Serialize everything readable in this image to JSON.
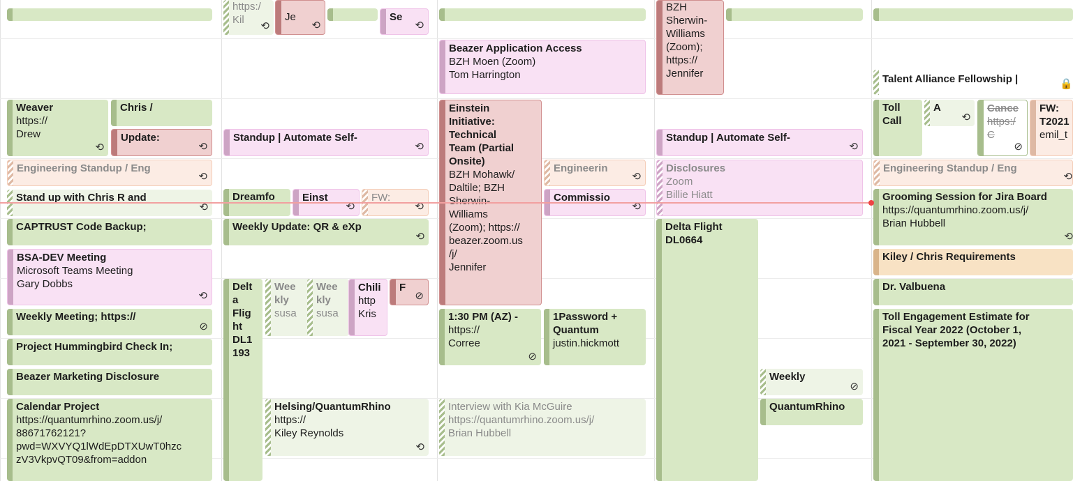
{
  "icons": {
    "repeat": "⟲",
    "no_sync": "⊘",
    "lock": "🔒"
  },
  "allday": {
    "d1": "",
    "d2a": "https:/\nKil",
    "d2b": "Je",
    "d2c": "Se",
    "d3": "",
    "d4a": "BZH\nSherwin-\nWilliams\n(Zoom);\nhttps://\nJennifer"
  },
  "events": {
    "beazer_app": {
      "title": "Beazer Application Access",
      "sub": "BZH Moen (Zoom)\nTom Harrington"
    },
    "talent": {
      "title": "Talent Alliance Fellowship |"
    },
    "weaver": {
      "title": "Weaver",
      "sub": "https://\nDrew"
    },
    "chris": {
      "title": "Chris /"
    },
    "update": {
      "title": "Update:"
    },
    "standup1": {
      "title": "Standup | Automate Self-"
    },
    "einstein": {
      "title": "Einstein\nInitiative:\nTechnical\nTeam (Partial\nOnsite)",
      "sub": "BZH Mohawk/\nDaltile; BZH\nSherwin-\nWilliams\n(Zoom); https://\nbeazer.zoom.us\n/j/\nJennifer"
    },
    "standup2": {
      "title": "Standup | Automate Self-"
    },
    "toll": {
      "title": "Toll\nCall"
    },
    "a": {
      "title": "A"
    },
    "cance": {
      "title": "Cance",
      "sub": "https:/\nC"
    },
    "fw1": {
      "title": "FW:\nT2021",
      "sub": "emil_t"
    },
    "eng1": {
      "title": "Engineering Standup / Eng"
    },
    "engin": {
      "title": "Engineerin"
    },
    "disclosures": {
      "title": "Disclosures",
      "sub": "Zoom\nBillie Hiatt"
    },
    "eng2": {
      "title": "Engineering Standup / Eng"
    },
    "standup_chris": {
      "title": "Stand up with Chris R and"
    },
    "dreamfo": {
      "title": "Dreamfo"
    },
    "einst": {
      "title": "Einst"
    },
    "fw2": {
      "title": "FW:"
    },
    "commissio": {
      "title": "Commissio"
    },
    "grooming": {
      "title": "Grooming Session for Jira Board",
      "sub": "https://quantumrhino.zoom.us/j/\nBrian Hubbell"
    },
    "captrust": {
      "title": "CAPTRUST Code Backup;"
    },
    "weekly_update": {
      "title": "Weekly Update: QR & eXp"
    },
    "delta1": {
      "title": "Delta Flight\nDL0664"
    },
    "bsa": {
      "title": "BSA-DEV Meeting",
      "sub": "Microsoft Teams Meeting\nGary Dobbs"
    },
    "kiley_chris": {
      "title": "Kiley / Chris Requirements"
    },
    "delt2": {
      "title": "Delt\na\nFlig\nht\nDL1\n193"
    },
    "wee1": {
      "title": "Wee\nkly",
      "sub": "susa"
    },
    "wee2": {
      "title": "Wee\nkly",
      "sub": "susa"
    },
    "chili": {
      "title": "Chili",
      "sub": "http\nKris"
    },
    "f": {
      "title": "F"
    },
    "valbuena": {
      "title": "Dr. Valbuena"
    },
    "weekly_meeting": {
      "title": "Weekly Meeting; https://"
    },
    "az130": {
      "title": "1:30 PM (AZ) -",
      "sub": "https://\nCorree"
    },
    "onepass": {
      "title": "1Password +\nQuantum",
      "sub": "justin.hickmott"
    },
    "toll_est": {
      "title": "Toll Engagement Estimate for\nFiscal Year 2022 (October 1,\n2021 - September 30, 2022)"
    },
    "hummingbird": {
      "title": "Project Hummingbird Check In;"
    },
    "beazer_mkt": {
      "title": "Beazer Marketing Disclosure"
    },
    "weekly_s": {
      "title": "Weekly"
    },
    "calendar": {
      "title": "Calendar Project",
      "sub": "https://quantumrhino.zoom.us/j/\n88671762121?\npwd=WXVYQ1lWdEpDTXUwT0hzc\nzV3VkpvQT09&from=addon"
    },
    "helsing": {
      "title": "Helsing/QuantumRhino",
      "sub": "https://\nKiley Reynolds"
    },
    "interview": {
      "title": "Interview with Kia McGuire",
      "sub": "https://quantumrhino.zoom.us/j/\nBrian Hubbell"
    },
    "qrhino": {
      "title": "QuantumRhino"
    }
  }
}
